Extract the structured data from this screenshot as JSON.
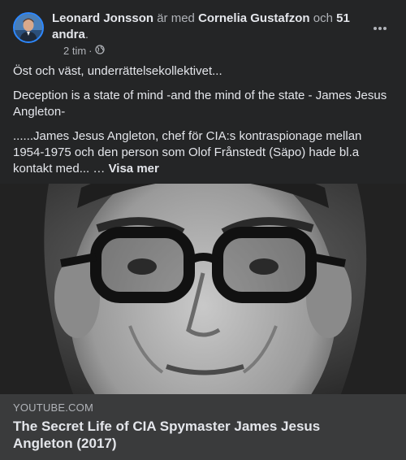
{
  "post": {
    "author": "Leonard Jonsson",
    "with_word": "är med",
    "tagged_person": "Cornelia Gustafzon",
    "and_word": "och",
    "others": "51 andra",
    "period": ".",
    "time": "2 tim",
    "time_separator": "·",
    "privacy_icon": "globe-icon",
    "more_icon": "more-horizontal-icon",
    "paragraphs": [
      "Öst och väst, underrättelsekollektivet...",
      "Deception is a state of mind -and the mind of the state - James Jesus Angleton-",
      "......James Jesus Angleton, chef för CIA:s kontraspionage mellan 1954-1975 och den person som Olof Frånstedt (Säpo) hade bl.a kontakt med..."
    ],
    "ellipsis": " … ",
    "see_more": "Visa mer"
  },
  "link_preview": {
    "source": "YOUTUBE.COM",
    "title": "The Secret Life of CIA Spymaster James Jesus Angleton (2017)"
  },
  "colors": {
    "background": "#242526",
    "preview_background": "#3a3b3c",
    "primary_text": "#e4e6eb",
    "secondary_text": "#b0b3b8",
    "avatar_ring": "#2d88ff"
  }
}
